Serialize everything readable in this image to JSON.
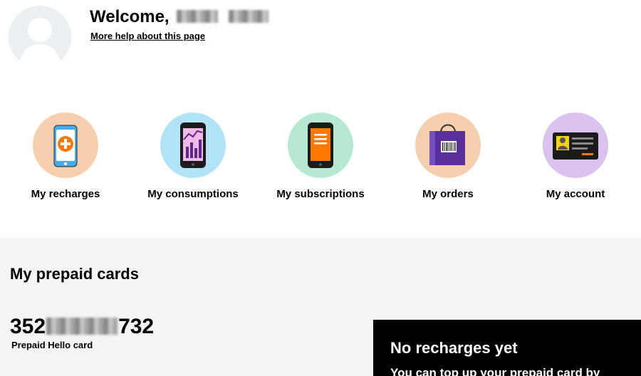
{
  "header": {
    "welcome_label": "Welcome,",
    "help_link": "More help about this page"
  },
  "quick_links": [
    {
      "label": "My recharges",
      "circle_color": "#f5cfb0",
      "icon": "phone-plus-icon"
    },
    {
      "label": "My consumptions",
      "circle_color": "#b3e3f6",
      "icon": "phone-chart-icon"
    },
    {
      "label": "My subscriptions",
      "circle_color": "#b6e8d2",
      "icon": "phone-list-icon"
    },
    {
      "label": "My orders",
      "circle_color": "#f5cfb0",
      "icon": "shopping-bag-icon"
    },
    {
      "label": "My account",
      "circle_color": "#d9c3ee",
      "icon": "id-card-icon"
    }
  ],
  "prepaid": {
    "section_title": "My prepaid cards",
    "card_number_start": "352",
    "card_number_end": "732",
    "card_type": "Prepaid Hello card",
    "panel_title": "No recharges yet",
    "panel_text": "You can top up your prepaid card by"
  },
  "colors": {
    "accent": "#ff7900",
    "section_bg": "#f4f4f4",
    "panel_bg": "#000000"
  }
}
